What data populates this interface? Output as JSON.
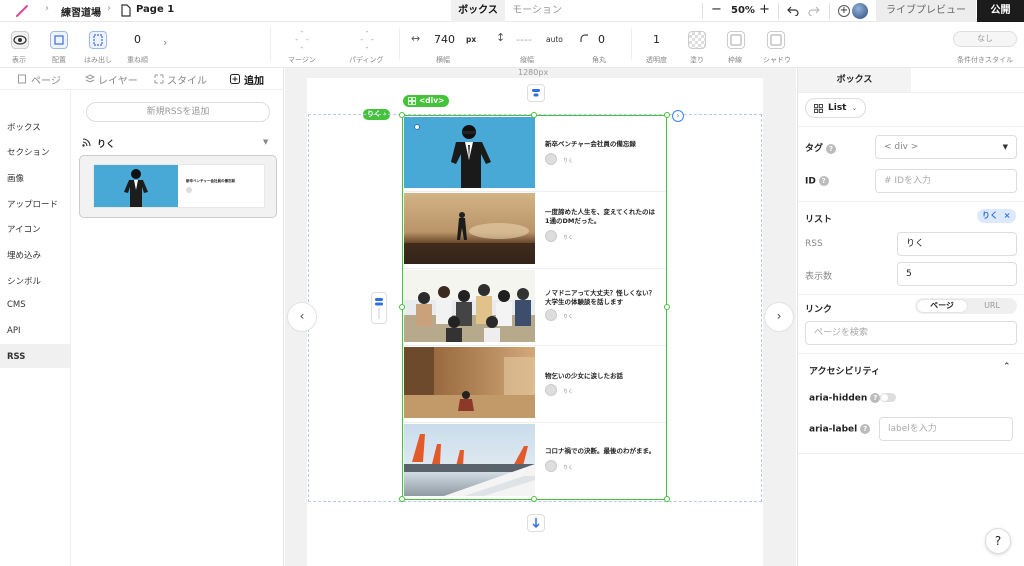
{
  "topbar": {
    "project": "練習道場",
    "page": "Page 1",
    "tab_box": "ボックス",
    "tab_motion": "モーション",
    "zoom": "50%",
    "minus": "−",
    "plus": "+",
    "live_preview": "ライブプレビュー",
    "publish": "公開"
  },
  "toolbar": {
    "display": "表示",
    "layout": "配置",
    "overflow": "はみ出し",
    "zindex_value": "0",
    "zindex": "重ね順",
    "margin": "マージン",
    "padding": "パディング",
    "width_value": "740",
    "width_unit": "px",
    "width": "横幅",
    "height_value": "----",
    "height_unit": "auto",
    "height": "縦幅",
    "radius_value": "0",
    "radius": "角丸",
    "opacity_value": "1",
    "opacity": "透明度",
    "fill": "塗り",
    "border": "枠線",
    "shadow": "シャドウ",
    "cond_value": "なし",
    "cond": "条件付きスタイル"
  },
  "leftpanel": {
    "tabs": [
      "ページ",
      "レイヤー",
      "スタイル",
      "追加"
    ],
    "categories": [
      "ボックス",
      "セクション",
      "画像",
      "アップロード",
      "アイコン",
      "埋め込み",
      "シンボル",
      "CMS",
      "API",
      "RSS"
    ],
    "add_rss": "新規RSSを追加",
    "feed_name": "りく",
    "thumb_title": "新卒ベンチャー会社員の備忘録"
  },
  "canvas": {
    "ruler": "1280px",
    "tag_riku": "りく",
    "tag_div": "<div>",
    "items": [
      {
        "title": "新卒ベンチャー会社員の備忘録",
        "author": "りく"
      },
      {
        "title": "一度諦めた人生を、変えてくれたのは1通のDMだった。",
        "author": "りく"
      },
      {
        "title": "ノマドニアって大丈夫？怪しくない？大学生の体験談を話します",
        "author": "りく"
      },
      {
        "title": "物乞いの少女に涙したお話",
        "author": "りく"
      },
      {
        "title": "コロナ禍での決断。最後のわがまま。",
        "author": "りく"
      }
    ]
  },
  "rightpanel": {
    "tab": "ボックス",
    "list_select": "List",
    "tag_label": "タグ",
    "tag_value": "< div >",
    "id_label": "ID",
    "id_placeholder": "# IDを入力",
    "list_section": "リスト",
    "list_chip": "りく",
    "rss_label": "RSS",
    "rss_value": "りく",
    "count_label": "表示数",
    "count_value": "5",
    "link_label": "リンク",
    "link_page": "ページ",
    "link_url": "URL",
    "link_placeholder": "ページを検索",
    "a11y": "アクセシビリティ",
    "aria_hidden": "aria-hidden",
    "aria_label": "aria-label",
    "aria_label_placeholder": "labelを入力",
    "help": "?"
  },
  "colors": {
    "accent": "#44c23a",
    "blue": "#3b82f6",
    "dark": "#1c1c1c",
    "sky": "#49a9d6"
  }
}
